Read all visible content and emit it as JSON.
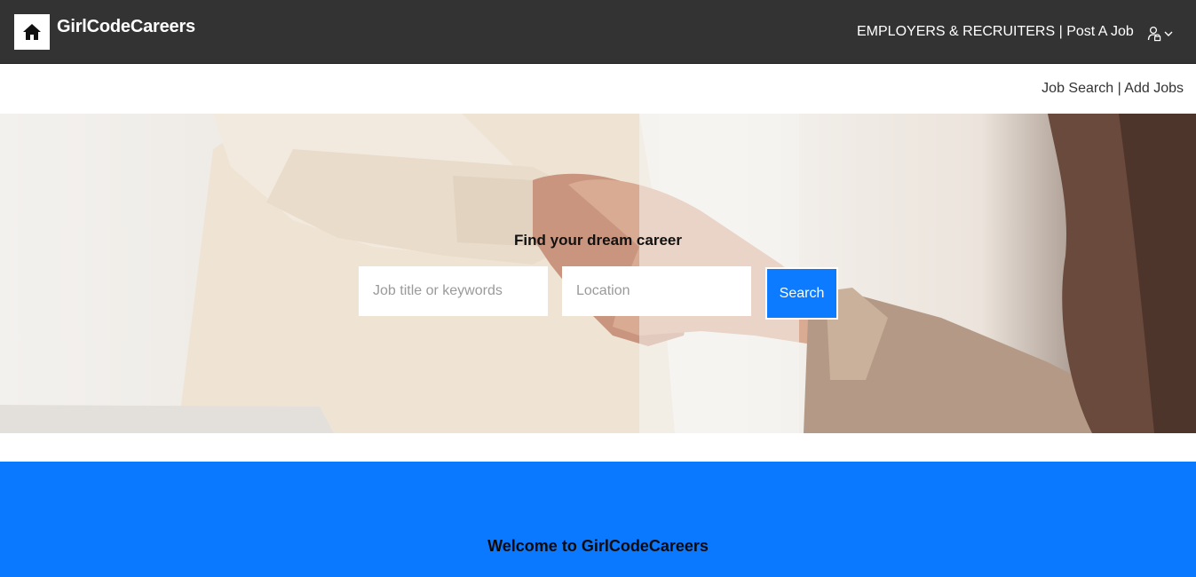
{
  "header": {
    "brand": "GirlCodeCareers",
    "employers_link": "EMPLOYERS & RECRUITERS",
    "separator": "|",
    "post_job_link": "Post A Job",
    "home_icon": "home-icon",
    "account_icon": "user-lock-icon",
    "background_color": "#333333"
  },
  "subnav": {
    "job_search": "Job Search",
    "separator": "|",
    "add_jobs": "Add Jobs"
  },
  "hero": {
    "title": "Find your dream career",
    "keywords_placeholder": "Job title or keywords",
    "location_placeholder": "Location",
    "search_label": "Search",
    "accent_color": "#0d7bff"
  },
  "welcome": {
    "title": "Welcome to GirlCodeCareers",
    "background_color": "#0b79ff"
  }
}
